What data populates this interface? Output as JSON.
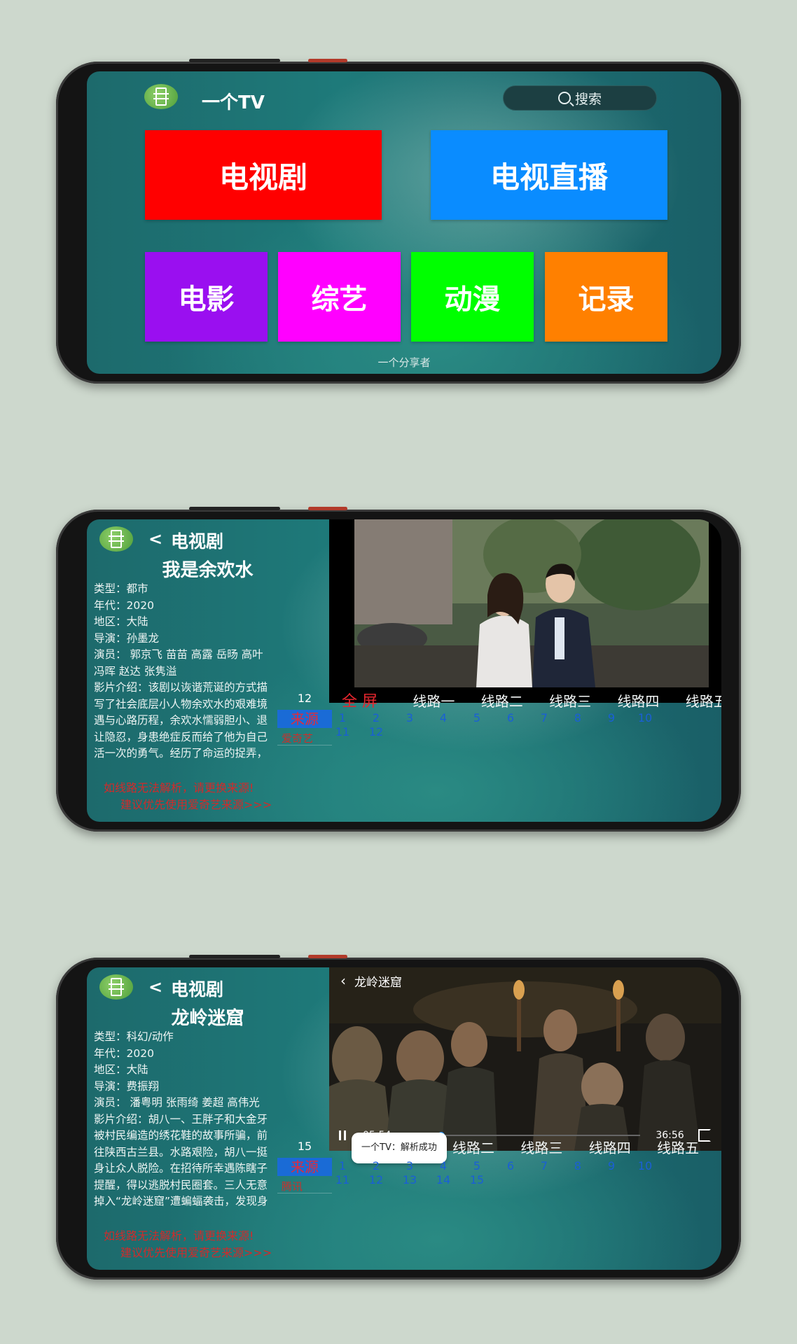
{
  "home": {
    "app_title": "一个TV",
    "search_label": "搜索",
    "tiles": [
      {
        "label": "电视剧",
        "color": "#ff0000"
      },
      {
        "label": "电视直播",
        "color": "#0a8cff"
      },
      {
        "label": "电影",
        "color": "#9a0ff0"
      },
      {
        "label": "综艺",
        "color": "#ff00ff"
      },
      {
        "label": "动漫",
        "color": "#00ff00"
      },
      {
        "label": "记录",
        "color": "#ff8000"
      }
    ],
    "footer": "一个分享者"
  },
  "detail1": {
    "back": "<",
    "category": "电视剧",
    "title": "我是余欢水",
    "info": {
      "type": "类型：都市",
      "year": "年代：2020",
      "region": "地区：大陆",
      "director": "导演：孙墨龙",
      "cast": "演员：  郭京飞 苗苗 高露 岳旸 高叶 冯晖 赵达 张隽溢",
      "desc": "影片介绍：该剧以诙谐荒诞的方式描写了社会底层小人物余欢水的艰难境遇与心路历程，余欢水懦弱胆小、退让隐忍，身患绝症反而给了他为自己活一次的勇气。经历了命运的捉弄，"
    },
    "episode_count": "12",
    "source_label": "来源",
    "source_name": "爱奇艺",
    "fullscreen": "全 屏",
    "routes": [
      "线路一",
      "线路二",
      "线路三",
      "线路四",
      "线路五"
    ],
    "episodes": [
      "1",
      "2",
      "3",
      "4",
      "5",
      "6",
      "7",
      "8",
      "9",
      "10",
      "11",
      "12"
    ],
    "warn1": "如线路无法解析，请更换来源!",
    "warn2": "建议优先使用爱奇艺来源>>>"
  },
  "detail2": {
    "back": "<",
    "category": "电视剧",
    "title": "龙岭迷窟",
    "info": {
      "type": "类型：科幻/动作",
      "year": "年代：2020",
      "region": "地区：大陆",
      "director": "导演：费振翔",
      "cast": "演员：  潘粤明 张雨绮 姜超 高伟光",
      "desc": "影片介绍：胡八一、王胖子和大金牙被村民编造的绣花鞋的故事所骗，前往陕西古兰县。水路艰险，胡八一挺身让众人脱险。在招待所幸遇陈瞎子提醒，得以逃脱村民圈套。三人无意掉入“龙岭迷窟”遭蝙蝠袭击，发现身"
    },
    "episode_count": "15",
    "source_label": "来源",
    "source_name": "腾讯",
    "routes": [
      "线路二",
      "线路三",
      "线路四",
      "线路五"
    ],
    "episodes": [
      "1",
      "2",
      "3",
      "4",
      "5",
      "6",
      "7",
      "8",
      "9",
      "10",
      "11",
      "12",
      "13",
      "14",
      "15"
    ],
    "player": {
      "title": "龙岭迷窟",
      "current_time": "05:54",
      "total_time": "36:56",
      "progress": 0.16
    },
    "toast": "一个TV：解析成功",
    "warn1": "如线路无法解析，请更换来源!",
    "warn2": "建议优先使用爱奇艺来源>>>"
  }
}
